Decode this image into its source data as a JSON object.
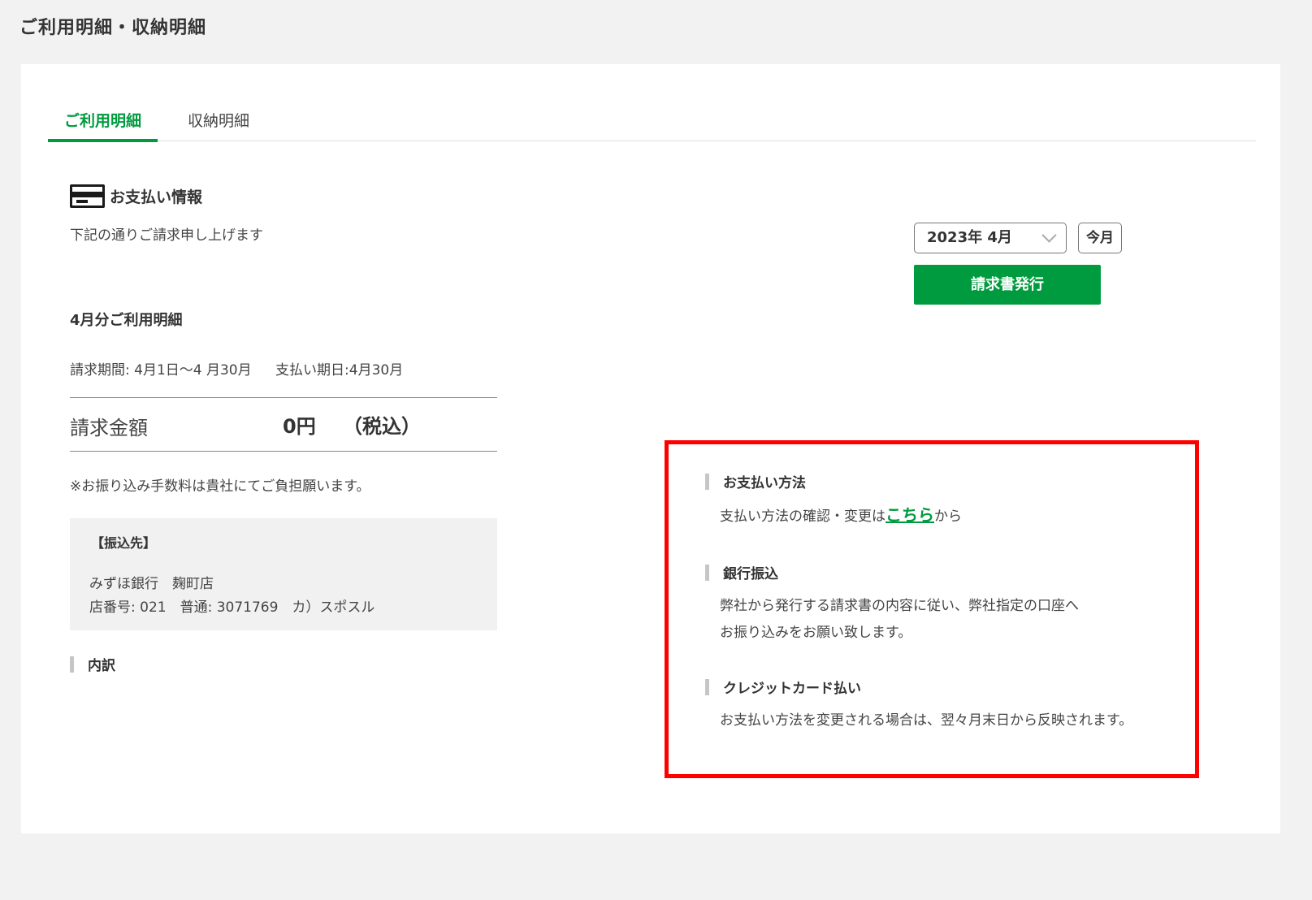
{
  "page_title": "ご利用明細・収納明細",
  "tabs": [
    {
      "label": "ご利用明細",
      "active": true
    },
    {
      "label": "収納明細",
      "active": false
    }
  ],
  "payment_info": {
    "title": "お支払い情報",
    "subtitle": "下記の通りご請求申し上げます"
  },
  "controls": {
    "month_selected": "2023年 4月",
    "today_label": "今月",
    "issue_invoice_label": "請求書発行"
  },
  "statement": {
    "heading": "4月分ご利用明細",
    "period": "請求期間: 4月1日〜4 月30月",
    "due": "支払い期日:4月30月",
    "amount_label": "請求金額",
    "amount_value": "0円",
    "amount_tax": "（税込）",
    "fee_note": "※お振り込み手数料は貴社にてご負担願います。"
  },
  "transfer": {
    "title": "【振込先】",
    "bank": "みずほ銀行　麹町店",
    "account": "店番号: 021　普通: 3071769　カ）スポスル"
  },
  "breakdown_label": "内訳",
  "info": {
    "method_title": "お支払い方法",
    "method_text_before": "支払い方法の確認・変更は",
    "method_link": "こちら",
    "method_text_after": "から",
    "bank_title": "銀行振込",
    "bank_line1": "弊社から発行する請求書の内容に従い、弊社指定の口座へ",
    "bank_line2": "お振り込みをお願い致します。",
    "credit_title": "クレジットカード払い",
    "credit_text": "お支払い方法を変更される場合は、翌々月末日から反映されます。"
  },
  "colors": {
    "accent": "#009b3e",
    "highlight_border": "#ff0000",
    "background": "#f2f2f2"
  }
}
